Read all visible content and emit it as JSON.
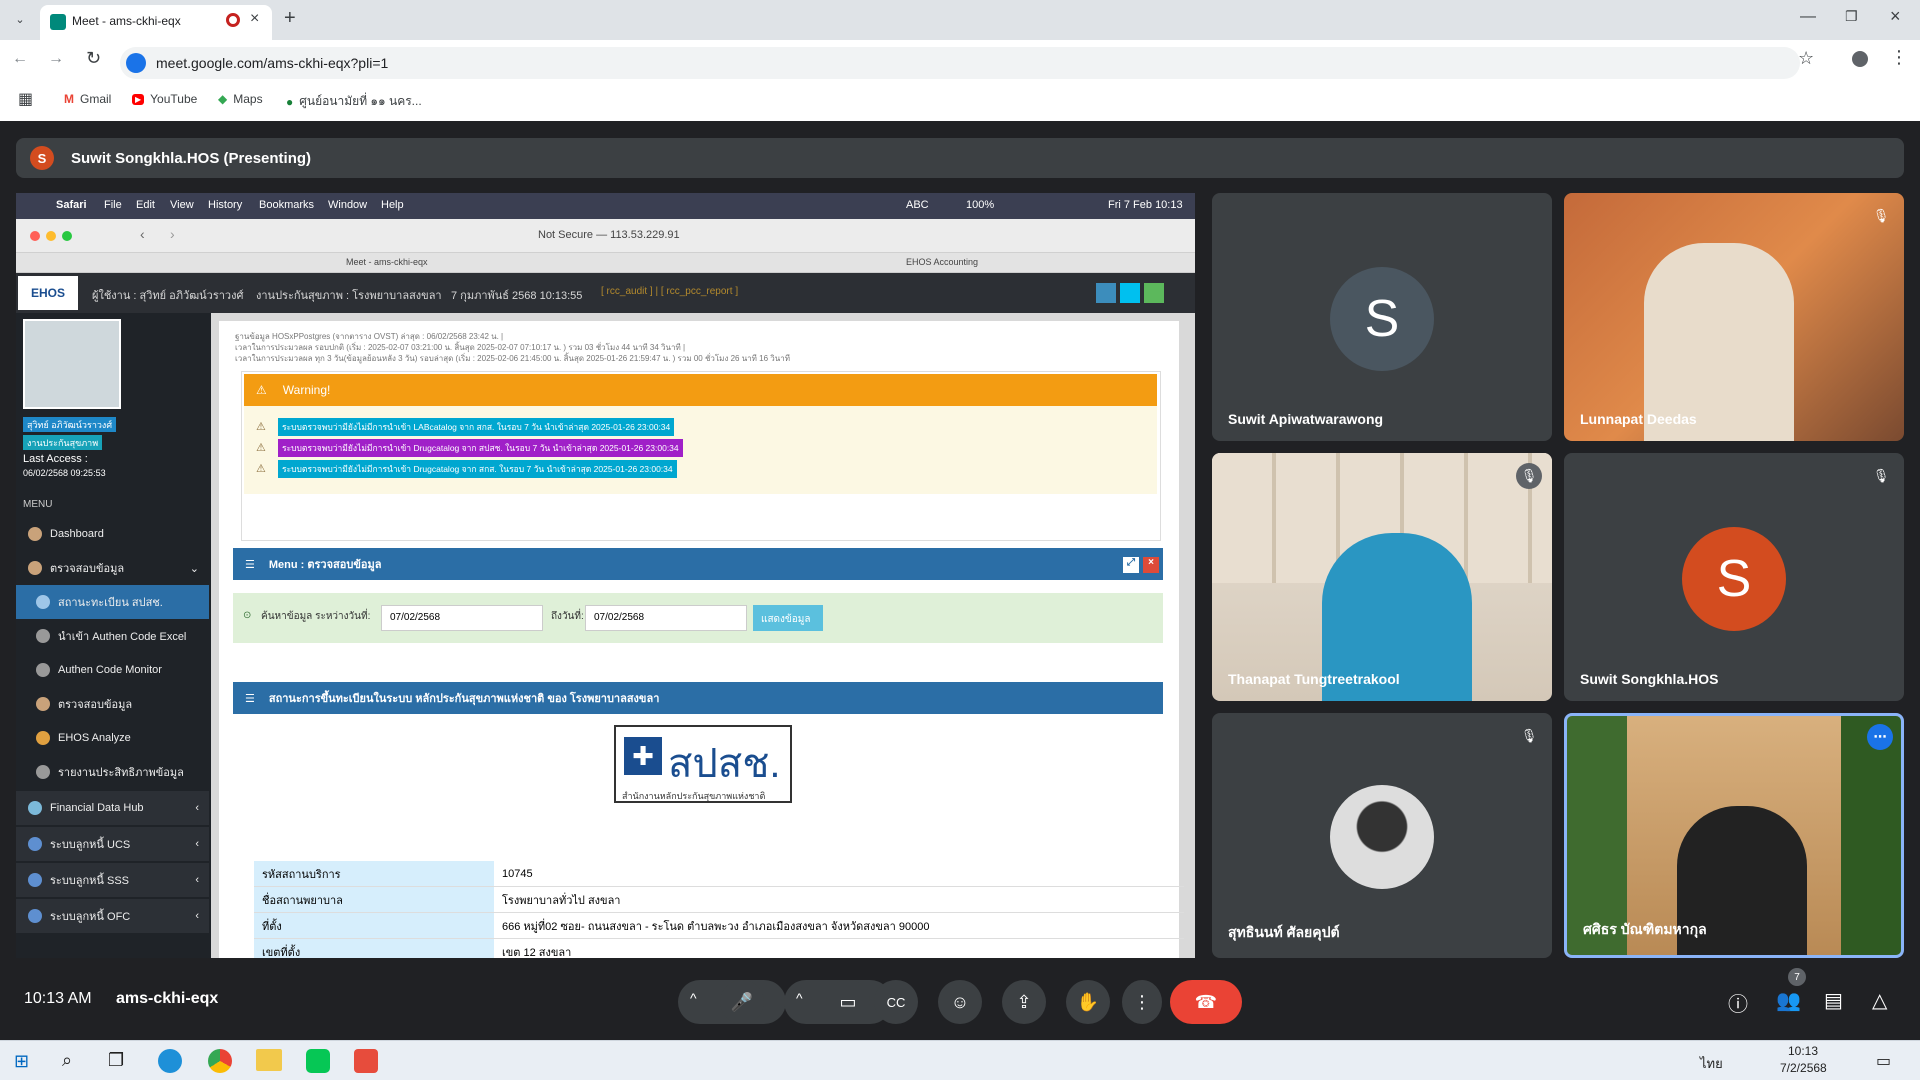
{
  "browser": {
    "tab_title": "Meet - ams-ckhi-eqx",
    "url": "meet.google.com/ams-ckhi-eqx?pli=1",
    "bookmarks": [
      "Gmail",
      "YouTube",
      "Maps",
      "ศูนย์อนามัยที่ ๑๑ นคร..."
    ]
  },
  "meet": {
    "presenter": "Suwit Songkhla.HOS (Presenting)",
    "presenter_initial": "S",
    "time": "10:13 AM",
    "meeting_code": "ams-ckhi-eqx",
    "participant_count": "7",
    "participants": [
      {
        "name": "Suwit Apiwatwarawong",
        "initial": "S"
      },
      {
        "name": "Lunnapat Deedas"
      },
      {
        "name": "Thanapat Tungtreetrakool"
      },
      {
        "name": "Suwit Songkhla.HOS",
        "initial": "S"
      },
      {
        "name": "สุทธินนท์ ศัลยคุปต์"
      },
      {
        "name": "ศศิธร บัณฑิตมหากุล"
      }
    ],
    "colors": {
      "accent": "#8ab4f8",
      "end_call": "#ea4335",
      "avatar_grey": "#4a5660",
      "avatar_orange": "#d34c1f"
    }
  },
  "mac": {
    "menu": [
      "Safari",
      "File",
      "Edit",
      "View",
      "History",
      "Bookmarks",
      "Window",
      "Help"
    ],
    "status": [
      "ABC",
      "100%",
      "Fri 7 Feb 10:13"
    ],
    "address": "Not Secure — 113.53.229.91",
    "tabs": [
      "Meet - ams-ckhi-eqx",
      "EHOS Accounting"
    ]
  },
  "ehos": {
    "logo": "EHOS",
    "user_line": "ผู้ใช้งาน : สุวิทย์ อภิวัฒน์วราวงศ์",
    "org_line": "งานประกันสุขภาพ : โรงพยาบาลสงขลา",
    "date_line": "7 กุมภาพันธ์ 2568 10:13:55",
    "links": "[ rcc_audit ] | [ rcc_pcc_report ]",
    "profile_name": "สุวิทย์ อภิวัฒน์วราวงศ์",
    "profile_dept": "งานประกันสุขภาพ",
    "last_access_label": "Last Access :",
    "last_access": "06/02/2568 09:25:53",
    "menu_label": "MENU",
    "sidebar": [
      "Dashboard",
      "ตรวจสอบข้อมูล",
      "สถานะทะเบียน สปสช.",
      "นำเข้า Authen Code Excel",
      "Authen Code Monitor",
      "ตรวจสอบข้อมูล",
      "EHOS Analyze",
      "รายงานประสิทธิภาพข้อมูล",
      "Financial Data Hub",
      "ระบบลูกหนี้ UCS",
      "ระบบลูกหนี้ SSS",
      "ระบบลูกหนี้ OFC"
    ],
    "info_lines": [
      "ฐานข้อมูล HOSxPPostgres (จากตาราง OVST) ล่าสุด : 06/02/2568 23:42 น. |",
      "เวลาในการประมวลผล รอบปกติ (เริ่ม : 2025-02-07 03:21:00 น. สิ้นสุด 2025-02-07 07:10:17 น. ) รวม 03 ชั่วโมง 44 นาที 34 วินาที |",
      "เวลาในการประมวลผล ทุก 3 วัน(ข้อมูลย้อนหลัง 3 วัน) รอบล่าสุด (เริ่ม : 2025-02-06 21:45:00 น. สิ้นสุด 2025-01-26 21:59:47 น. ) รวม 00 ชั่วโมง 26 นาที 16 วินาที"
    ],
    "warning_title": "Warning!",
    "warnings": [
      "ระบบตรวจพบว่ามียังไม่มีการนำเข้า LABcatalog จาก สกส. ในรอบ 7 วัน นำเข้าล่าสุด 2025-01-26 23:00:34",
      "ระบบตรวจพบว่ามียังไม่มีการนำเข้า Drugcatalog จาก สปสช. ในรอบ 7 วัน นำเข้าล่าสุด 2025-01-26 23:00:34",
      "ระบบตรวจพบว่ามียังไม่มีการนำเข้า Drugcatalog จาก สกส. ในรอบ 7 วัน นำเข้าล่าสุด 2025-01-26 23:00:34"
    ],
    "menu_title": "Menu : ตรวจสอบข้อมูล",
    "search_label": "ค้นหาข้อมูล ระหว่างวันที่:",
    "from_date": "07/02/2568",
    "to_label": "ถึงวันที่:",
    "to_date": "07/02/2568",
    "show_button": "แสดงข้อมูล",
    "status_title": "สถานะการขึ้นทะเบียนในระบบ หลักประกันสุขภาพแห่งชาติ ของ โรงพยาบาลสงขลา",
    "nhso_logo": "สปสช.",
    "nhso_sub": "สำนักงานหลักประกันสุขภาพแห่งชาติ",
    "table": [
      [
        "รหัสสถานบริการ",
        "10745"
      ],
      [
        "ชื่อสถานพยาบาล",
        "โรงพยาบาลทั่วไป สงขลา"
      ],
      [
        "ที่ตั้ง",
        "666 หมู่ที่02 ซอย- ถนนสงขลา - ระโนด ตำบลพะวง อำเภอเมืองสงขลา จังหวัดสงขลา 90000"
      ],
      [
        "เขตที่ตั้ง",
        "เขต 12 สงขลา"
      ]
    ]
  },
  "taskbar": {
    "time": "10:13",
    "date": "7/2/2568",
    "lang": "ไทย"
  }
}
